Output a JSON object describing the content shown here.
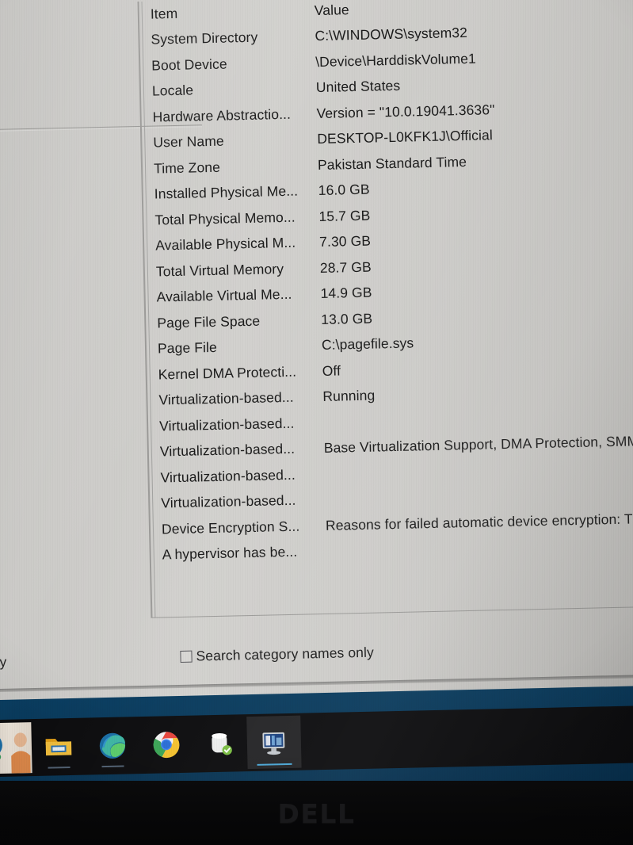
{
  "window": {
    "table": {
      "columns": [
        "Item",
        "Value"
      ],
      "rows": [
        {
          "item": "System Directory",
          "value": "C:\\WINDOWS\\system32"
        },
        {
          "item": "Boot Device",
          "value": "\\Device\\HarddiskVolume1"
        },
        {
          "item": "Locale",
          "value": "United States"
        },
        {
          "item": "Hardware Abstractio...",
          "value": "Version = \"10.0.19041.3636\""
        },
        {
          "item": "User Name",
          "value": "DESKTOP-L0KFK1J\\Official"
        },
        {
          "item": "Time Zone",
          "value": "Pakistan Standard Time"
        },
        {
          "item": "Installed Physical Me...",
          "value": "16.0 GB"
        },
        {
          "item": "Total Physical Memo...",
          "value": "15.7 GB"
        },
        {
          "item": "Available Physical M...",
          "value": "7.30 GB"
        },
        {
          "item": "Total Virtual Memory",
          "value": "28.7 GB"
        },
        {
          "item": "Available Virtual Me...",
          "value": "14.9 GB"
        },
        {
          "item": "Page File Space",
          "value": "13.0 GB"
        },
        {
          "item": "Page File",
          "value": "C:\\pagefile.sys"
        },
        {
          "item": "Kernel DMA Protecti...",
          "value": "Off"
        },
        {
          "item": "Virtualization-based...",
          "value": "Running"
        },
        {
          "item": "Virtualization-based...",
          "value": ""
        },
        {
          "item": "Virtualization-based...",
          "value": "Base Virtualization Support, DMA Protection, SMM"
        },
        {
          "item": "Virtualization-based...",
          "value": ""
        },
        {
          "item": "Virtualization-based...",
          "value": ""
        },
        {
          "item": "Device Encryption S...",
          "value": "Reasons for failed automatic device encryption: TP"
        },
        {
          "item": "A hypervisor has be...",
          "value": ""
        }
      ]
    },
    "search_bar": {
      "left_partial_label": "ly",
      "category_checkbox_label": "Search category names only",
      "category_checkbox_checked": false
    }
  },
  "taskbar": {
    "items": [
      {
        "name": "app-thumbnail",
        "label": ""
      },
      {
        "name": "file-explorer",
        "label": "File Explorer"
      },
      {
        "name": "microsoft-edge",
        "label": "Microsoft Edge"
      },
      {
        "name": "google-chrome",
        "label": "Google Chrome"
      },
      {
        "name": "storage-app",
        "label": "Storage"
      },
      {
        "name": "system-information",
        "label": "System Information"
      }
    ]
  },
  "bezel": {
    "brand": "DELL"
  },
  "colors": {
    "window_bg": "#cbcac7",
    "text": "#1a1a1a",
    "wallpaper_blue": "#0d4d7a",
    "taskbar": "#0c0c0e",
    "accent": "#4aa8d8"
  }
}
